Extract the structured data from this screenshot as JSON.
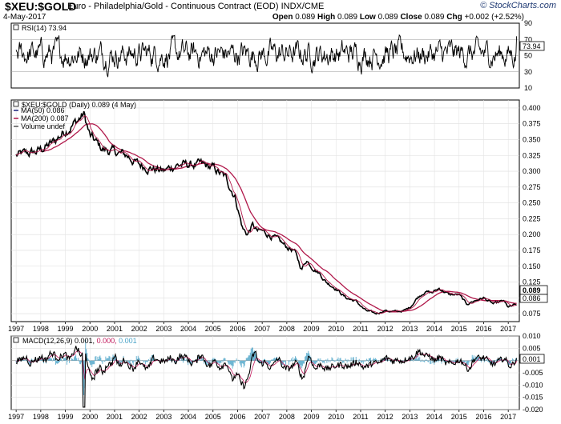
{
  "header": {
    "symbol": "$XEU:$GOLD",
    "description": "Euro - Philadelphia/Gold - Continuous Contract (EOD)  INDX/CME",
    "date": "4-May-2017",
    "brand": "© StockCharts.com",
    "open_label": "Open",
    "open": "0.089",
    "high_label": "High",
    "high": "0.089",
    "low_label": "Low",
    "low": "0.089",
    "close_label": "Close",
    "close": "0.089",
    "chg_label": "Chg",
    "chg": "+0.002 (+2.52%)"
  },
  "rsi_panel": {
    "label": "RSI(14) 73.94",
    "current_value": "73.94",
    "ticks": [
      "90",
      "70",
      "50",
      "30",
      "10"
    ]
  },
  "price_panel": {
    "label": "$XEU:$GOLD (Daily) 0.089 (4 May)",
    "legend": [
      {
        "text": "MA(50) 0.086",
        "color": "#1a237e"
      },
      {
        "text": "MA(200) 0.087",
        "color": "#b0184a"
      },
      {
        "text": "Volume undef",
        "color": "#555555"
      }
    ],
    "ticks": [
      "0.400",
      "0.375",
      "0.350",
      "0.325",
      "0.300",
      "0.275",
      "0.250",
      "0.225",
      "0.200",
      "0.175",
      "0.150",
      "0.125",
      "0.100",
      "0.075"
    ],
    "current_badge": "0.089",
    "ma_badge": "0.086"
  },
  "macd_panel": {
    "label_prefix": "MACD(12,26,9) 0.001,",
    "label_signal": "0.000,",
    "label_hist": "0.001",
    "current_value": "0.001",
    "ticks": [
      "0.010",
      "0.005",
      "0.000",
      "-0.005",
      "-0.010",
      "-0.015",
      "-0.020"
    ]
  },
  "x_axis_labels": [
    "1997",
    "1998",
    "1999",
    "2000",
    "2001",
    "2002",
    "2003",
    "2004",
    "2005",
    "2006",
    "2007",
    "2008",
    "2009",
    "2010",
    "2011",
    "2012",
    "2013",
    "2014",
    "2015",
    "2016",
    "2017"
  ],
  "chart_data": [
    {
      "type": "line",
      "name": "RSI(14)",
      "ylim": [
        10,
        90
      ],
      "gridlines": [
        30,
        50,
        70
      ],
      "last": 73.94
    },
    {
      "type": "line",
      "name": "$XEU:$GOLD (Daily)",
      "ylim": [
        0.0625,
        0.4125
      ],
      "x": [
        1997.0,
        1997.8,
        1998.5,
        1999.0,
        1999.5,
        1999.75,
        2000.0,
        2000.5,
        2001.0,
        2001.5,
        2002.0,
        2002.5,
        2003.0,
        2003.5,
        2004.0,
        2004.5,
        2005.0,
        2005.5,
        2005.9,
        2006.2,
        2006.4,
        2006.6,
        2006.8,
        2007.0,
        2007.5,
        2008.0,
        2008.3,
        2008.6,
        2008.8,
        2009.0,
        2009.3,
        2009.6,
        2010.0,
        2010.4,
        2010.8,
        2011.2,
        2011.6,
        2012.0,
        2012.4,
        2012.8,
        2013.0,
        2013.3,
        2013.6,
        2013.9,
        2014.2,
        2014.6,
        2015.0,
        2015.3,
        2015.6,
        2016.0,
        2016.4,
        2016.8,
        2017.0,
        2017.34
      ],
      "series": [
        {
          "name": "Price",
          "values": [
            0.325,
            0.33,
            0.345,
            0.365,
            0.38,
            0.39,
            0.355,
            0.335,
            0.33,
            0.325,
            0.31,
            0.305,
            0.3,
            0.31,
            0.31,
            0.31,
            0.305,
            0.29,
            0.26,
            0.21,
            0.2,
            0.215,
            0.205,
            0.205,
            0.195,
            0.18,
            0.175,
            0.145,
            0.16,
            0.15,
            0.14,
            0.125,
            0.115,
            0.1,
            0.095,
            0.08,
            0.075,
            0.08,
            0.078,
            0.08,
            0.085,
            0.1,
            0.11,
            0.108,
            0.115,
            0.105,
            0.105,
            0.09,
            0.095,
            0.1,
            0.09,
            0.095,
            0.085,
            0.089
          ]
        },
        {
          "name": "MA(50)",
          "last": 0.086
        },
        {
          "name": "MA(200)",
          "last": 0.087
        }
      ]
    },
    {
      "type": "line",
      "name": "MACD(12,26,9)",
      "ylim": [
        -0.02,
        0.01
      ],
      "series": [
        {
          "name": "MACD",
          "last": 0.001
        },
        {
          "name": "Signal",
          "last": 0.0
        },
        {
          "name": "Histogram",
          "last": 0.001
        }
      ]
    }
  ],
  "colors": {
    "price": "#000000",
    "ma50": "#1a237e",
    "ma200": "#b0184a",
    "macd": "#000000",
    "signal": "#c2185b",
    "histogram": "#4aa3c7",
    "grid": "#cccccc",
    "brand": "#1f3a73"
  }
}
